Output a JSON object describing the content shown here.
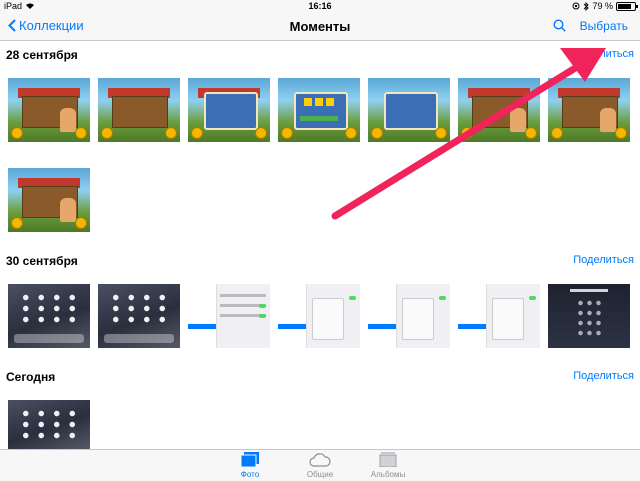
{
  "status_bar": {
    "device": "iPad",
    "time": "16:16",
    "battery_text": "79 %",
    "battery_level": 0.79
  },
  "nav": {
    "back_label": "Коллекции",
    "title": "Моменты",
    "select_label": "Выбрать",
    "search_icon": "search-icon",
    "back_icon": "chevron-left-icon"
  },
  "sections": [
    {
      "date": "28 сентября",
      "share_label": "Поделиться"
    },
    {
      "date": "30 сентября",
      "share_label": "Поделиться"
    },
    {
      "date": "Сегодня",
      "share_label": "Поделиться"
    }
  ],
  "tabs": [
    {
      "label": "Фото",
      "icon": "photos-icon",
      "active": true
    },
    {
      "label": "Общие",
      "icon": "cloud-icon",
      "active": false
    },
    {
      "label": "Альбомы",
      "icon": "albums-icon",
      "active": false
    }
  ],
  "colors": {
    "accent": "#007aff",
    "arrow": "#f0235a",
    "inactive": "#8e8e93"
  }
}
